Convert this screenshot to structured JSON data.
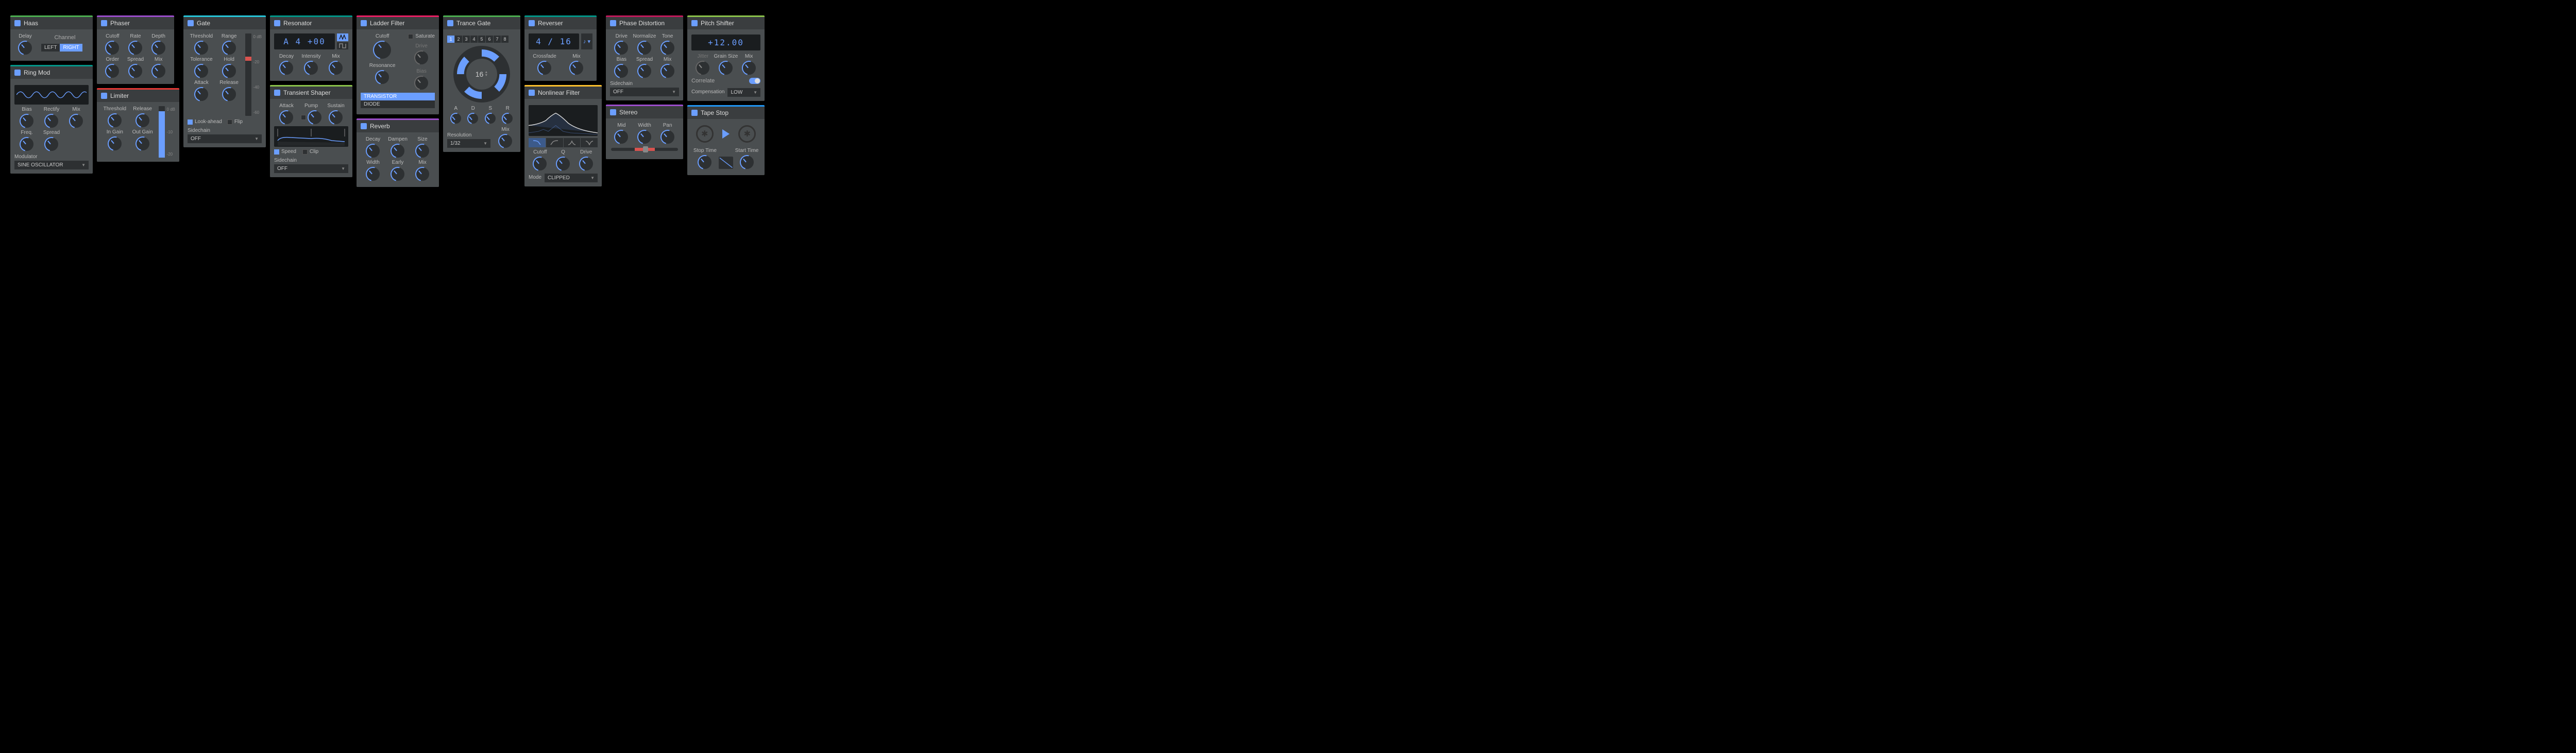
{
  "haas": {
    "title": "Haas",
    "delay": "Delay",
    "channel": "Channel",
    "left": "LEFT",
    "right": "RIGHT"
  },
  "ringmod": {
    "title": "Ring Mod",
    "bias": "Bias",
    "rectify": "Rectify",
    "mix": "Mix",
    "freq": "Freq.",
    "spread": "Spread",
    "modulator": "Modulator",
    "modulator_val": "SINE OSCILLATOR"
  },
  "phaser": {
    "title": "Phaser",
    "cutoff": "Cutoff",
    "rate": "Rate",
    "depth": "Depth",
    "order": "Order",
    "spread": "Spread",
    "mix": "Mix"
  },
  "limiter": {
    "title": "Limiter",
    "threshold": "Threshold",
    "release": "Release",
    "ingain": "In Gain",
    "outgain": "Out Gain",
    "ticks": [
      "0 dB",
      "-10",
      "-20"
    ]
  },
  "gate": {
    "title": "Gate",
    "threshold": "Threshold",
    "range": "Range",
    "tolerance": "Tolerance",
    "hold": "Hold",
    "attack": "Attack",
    "release": "Release",
    "lookahead": "Look-ahead",
    "flip": "Flip",
    "sidechain": "Sidechain",
    "sidechain_val": "OFF",
    "ticks": [
      "0 dB",
      "-20",
      "-40",
      "-60"
    ]
  },
  "resonator": {
    "title": "Resonator",
    "pitch": "A 4 +00",
    "decay": "Decay",
    "intensity": "Intensity",
    "mix": "Mix"
  },
  "transient": {
    "title": "Transient Shaper",
    "attack": "Attack",
    "pump": "Pump",
    "sustain": "Sustain",
    "speed": "Speed",
    "clip": "Clip",
    "sidechain": "Sidechain",
    "sidechain_val": "OFF"
  },
  "ladder": {
    "title": "Ladder Filter",
    "cutoff": "Cutoff",
    "saturate": "Saturate",
    "drive": "Drive",
    "resonance": "Resonance",
    "bias": "Bias",
    "transistor": "TRANSISTOR",
    "diode": "DIODE"
  },
  "reverb": {
    "title": "Reverb",
    "decay": "Decay",
    "dampen": "Dampen",
    "size": "Size",
    "width": "Width",
    "early": "Early",
    "mix": "Mix"
  },
  "trance": {
    "title": "Trance Gate",
    "steps": [
      "1",
      "2",
      "3",
      "4",
      "5",
      "6",
      "7",
      "8"
    ],
    "count": "16",
    "a": "A",
    "d": "D",
    "s": "S",
    "r": "R",
    "resolution": "Resolution",
    "res_val": "1/32",
    "mix": "Mix"
  },
  "reverser": {
    "title": "Reverser",
    "display": "4 / 16",
    "crossfade": "Crossfade",
    "mix": "Mix"
  },
  "nonlinear": {
    "title": "Nonlinear Filter",
    "cutoff": "Cutoff",
    "q": "Q",
    "drive": "Drive",
    "mode": "Mode",
    "mode_val": "CLIPPED"
  },
  "phasedist": {
    "title": "Phase Distortion",
    "drive": "Drive",
    "normalize": "Normalize",
    "tone": "Tone",
    "bias": "Bias",
    "spread": "Spread",
    "mix": "Mix",
    "sidechain": "Sidechain",
    "sidechain_val": "OFF"
  },
  "stereo": {
    "title": "Stereo",
    "mid": "Mid",
    "width": "Width",
    "pan": "Pan"
  },
  "pitch": {
    "title": "Pitch Shifter",
    "display": "+12.00",
    "jitter": "Jitter",
    "grain": "Grain Size",
    "mix": "Mix",
    "correlate": "Correlate",
    "compensation": "Compensation",
    "comp_val": "LOW"
  },
  "tape": {
    "title": "Tape Stop",
    "stop": "Stop Time",
    "start": "Start Time"
  }
}
